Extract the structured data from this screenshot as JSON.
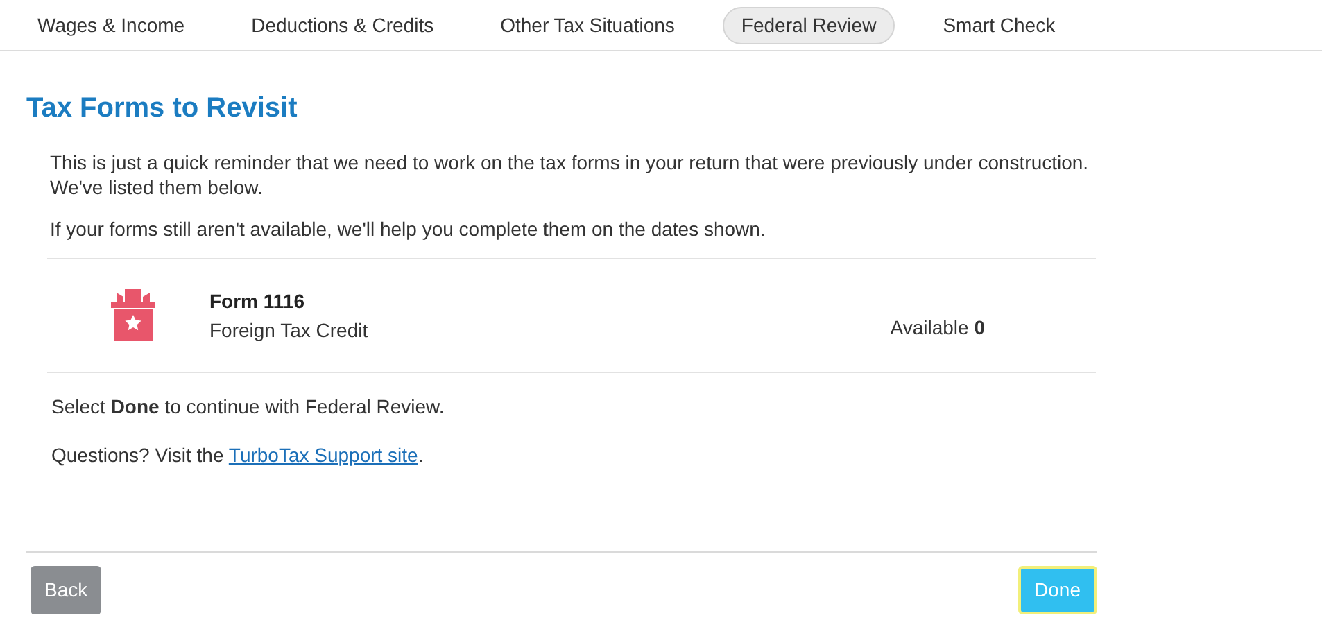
{
  "tabs": [
    {
      "label": "Wages & Income",
      "selected": false
    },
    {
      "label": "Deductions & Credits",
      "selected": false
    },
    {
      "label": "Other Tax Situations",
      "selected": false
    },
    {
      "label": "Federal Review",
      "selected": true
    },
    {
      "label": "Smart Check",
      "selected": false
    }
  ],
  "heading": "Tax Forms to Revisit",
  "paragraphs": [
    "This is just a quick reminder that we need to work on the tax forms in your return that were previously under construction. We've listed them below.",
    "If your forms still aren't available, we'll help you complete them on the dates shown."
  ],
  "forms": [
    {
      "name": "Form 1116",
      "description": "Foreign Tax Credit",
      "availability": "Available **0**"
    }
  ],
  "instruction": "Select **Done** to continue with Federal Review.",
  "questions": {
    "before": "Questions? Visit the ",
    "link": "TurboTax Support site",
    "after": "."
  },
  "buttons": {
    "back": "Back",
    "done": "Done"
  }
}
